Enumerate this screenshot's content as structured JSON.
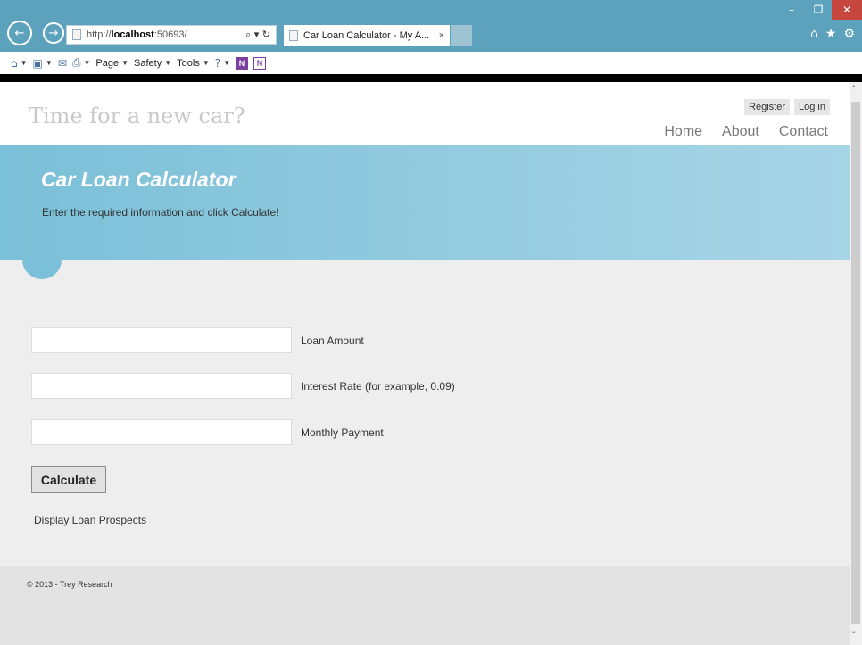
{
  "browser": {
    "url_prefix": "http://",
    "url_host": "localhost",
    "url_port": ":50693/",
    "tab_title": "Car Loan Calculator - My A...",
    "tab_close": "×",
    "back_glyph": "←",
    "fwd_glyph": "→",
    "addr_tools": "⌕ ▾ ↻",
    "window_controls": {
      "minimize": "–",
      "restore": "❐",
      "close": "✕"
    },
    "right_icons": {
      "home": "⌂",
      "favorites": "★",
      "settings": "⚙"
    },
    "command_bar": {
      "page": "Page",
      "safety": "Safety",
      "tools": "Tools",
      "help_glyph": "?",
      "onenote_1": "N",
      "onenote_2": "N"
    }
  },
  "site": {
    "title": "Time for a new car?",
    "login": {
      "register": "Register",
      "log_in": "Log in"
    },
    "nav": {
      "home": "Home",
      "about": "About",
      "contact": "Contact"
    }
  },
  "hero": {
    "title": "Car Loan Calculator",
    "subtitle": "Enter the required information and click Calculate!"
  },
  "form": {
    "loan_amount": {
      "label": "Loan Amount",
      "value": ""
    },
    "interest_rate": {
      "label": "Interest Rate (for example, 0.09)",
      "value": ""
    },
    "monthly_payment": {
      "label": "Monthly Payment",
      "value": ""
    },
    "calculate_label": "Calculate",
    "prospects_link": "Display Loan Prospects"
  },
  "footer": {
    "text": "© 2013 - Trey Research"
  },
  "scrollbar": {
    "up": "˄",
    "down": "˅"
  },
  "colors": {
    "titlebar": "#5da2bc",
    "hero": "#92cadf",
    "main_bg": "#efeeef",
    "footer_bg": "#e3e3e3",
    "close_button": "#c7463d"
  }
}
